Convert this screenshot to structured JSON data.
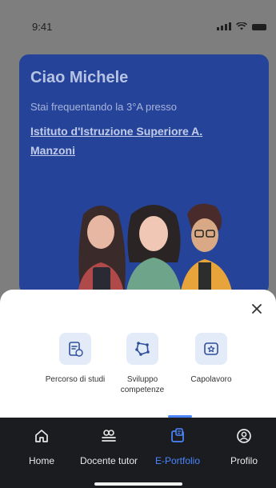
{
  "status_bar": {
    "time": "9:41"
  },
  "hero": {
    "greeting": "Ciao Michele",
    "subtitle": "Stai frequentando la 3°A presso",
    "school": "Istituto d'Istruzione Superiore A. Manzoni"
  },
  "sheet": {
    "options": [
      {
        "label": "Percorso di studi",
        "icon": "document-swap-icon"
      },
      {
        "label": "Sviluppo competenze",
        "icon": "network-polygon-icon"
      },
      {
        "label": "Capolavoro",
        "icon": "star-frame-icon"
      }
    ]
  },
  "tabbar": {
    "items": [
      {
        "label": "Home",
        "icon": "home-icon"
      },
      {
        "label": "Docente tutor",
        "icon": "tutor-icon"
      },
      {
        "label": "E-Portfolio",
        "icon": "portfolio-icon",
        "active": true
      },
      {
        "label": "Profilo",
        "icon": "profile-icon"
      }
    ]
  },
  "colors": {
    "accent": "#4a86ff",
    "hero_bg": "#26439a",
    "tabbar_bg": "#1b1c1f",
    "icon_tile": "#e3ebf8"
  }
}
